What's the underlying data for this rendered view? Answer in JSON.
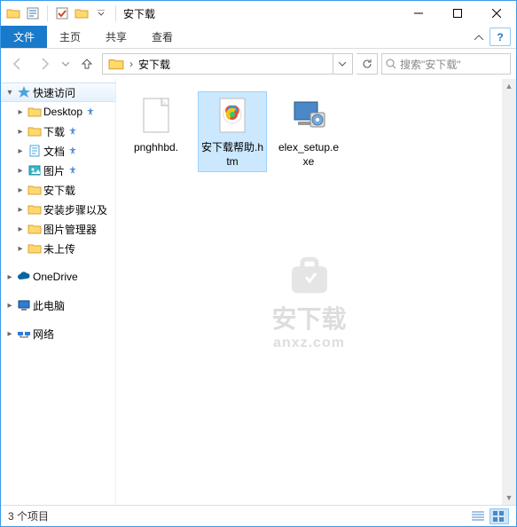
{
  "window": {
    "title": "安下载"
  },
  "qat": {
    "checked": true
  },
  "ribbon": {
    "file": "文件",
    "tabs": [
      "主页",
      "共享",
      "查看"
    ]
  },
  "breadcrumb": {
    "current": "安下载"
  },
  "search": {
    "placeholder": "搜索\"安下载\""
  },
  "sidebar": {
    "quickaccess": {
      "label": "快速访问",
      "expanded": true
    },
    "items": [
      {
        "label": "Desktop",
        "icon": "folder",
        "pinned": true
      },
      {
        "label": "下载",
        "icon": "folder",
        "pinned": true
      },
      {
        "label": "文档",
        "icon": "doc",
        "pinned": true
      },
      {
        "label": "图片",
        "icon": "pictures",
        "pinned": true
      },
      {
        "label": "安下载",
        "icon": "folder",
        "pinned": false
      },
      {
        "label": "安装步骤以及",
        "icon": "folder",
        "pinned": false
      },
      {
        "label": "图片管理器",
        "icon": "folder",
        "pinned": false
      },
      {
        "label": "未上传",
        "icon": "folder",
        "pinned": false
      }
    ],
    "onedrive": "OneDrive",
    "thispc": "此电脑",
    "network": "网络"
  },
  "files": [
    {
      "name": "pnghhbd.",
      "type": "blank",
      "selected": false
    },
    {
      "name": "安下载帮助.htm",
      "type": "html",
      "selected": true
    },
    {
      "name": "elex_setup.exe",
      "type": "exe",
      "selected": false
    }
  ],
  "status": {
    "count": "3 个项目"
  },
  "watermark": {
    "main": "安下载",
    "sub": "anxz.com"
  }
}
